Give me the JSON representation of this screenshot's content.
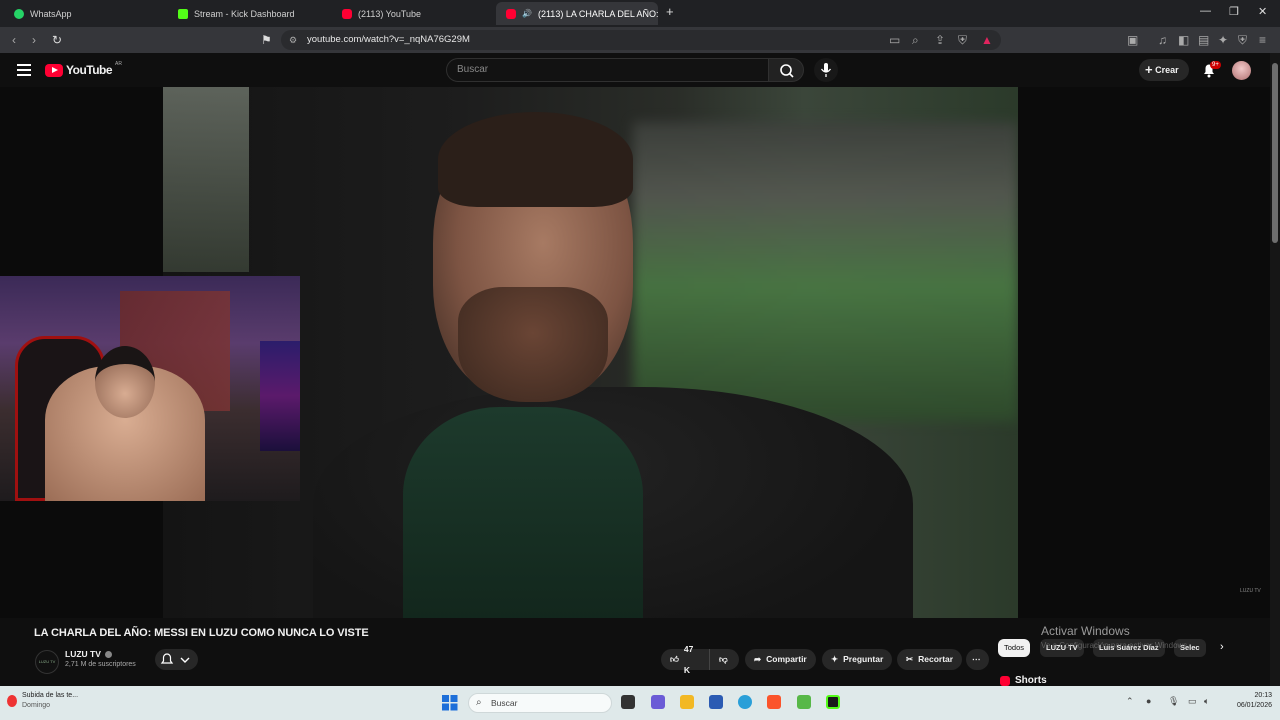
{
  "browser": {
    "tabs": [
      {
        "label": "WhatsApp",
        "icon": "whatsapp-icon"
      },
      {
        "label": "Stream - Kick Dashboard",
        "icon": "kick-icon"
      },
      {
        "label": "(2113) YouTube",
        "icon": "youtube-icon"
      },
      {
        "label": "(2113) LA CHARLA DEL AÑO:",
        "icon": "youtube-icon",
        "active": true
      }
    ],
    "url": "youtube.com/watch?v=_nqNA76G29M"
  },
  "youtube": {
    "logo_text": "YouTube",
    "region": "AR",
    "search_placeholder": "Buscar",
    "create_label": "Crear",
    "notification_badge": "9+"
  },
  "video": {
    "title": "LA CHARLA DEL AÑO: MESSI EN LUZU COMO NUNCA LO VISTE",
    "channel": "LUZU TV",
    "channel_avatar_text": "LUZU TV",
    "subscribers": "2,71 M de suscriptores",
    "likes": "47 K",
    "share_label": "Compartir",
    "ask_label": "Preguntar",
    "clip_label": "Recortar",
    "watermark": "LUZU TV"
  },
  "chips": [
    "Todos",
    "LUZU TV",
    "Luis Suárez Díaz",
    "Selec"
  ],
  "overlay": {
    "activate_title": "Activar Windows",
    "activate_sub": "Ve a Configuración para activar Windows."
  },
  "sidebar": {
    "shorts_label": "Shorts"
  },
  "taskbar": {
    "weather_title": "Subida de las te...",
    "weather_sub": "Domingo",
    "search_placeholder": "Buscar",
    "time": "20:13",
    "date": "06/01/2026"
  },
  "colors": {
    "accent": "#ff0033",
    "background": "#0f0f0f",
    "taskbar": "#dfe9ea"
  }
}
